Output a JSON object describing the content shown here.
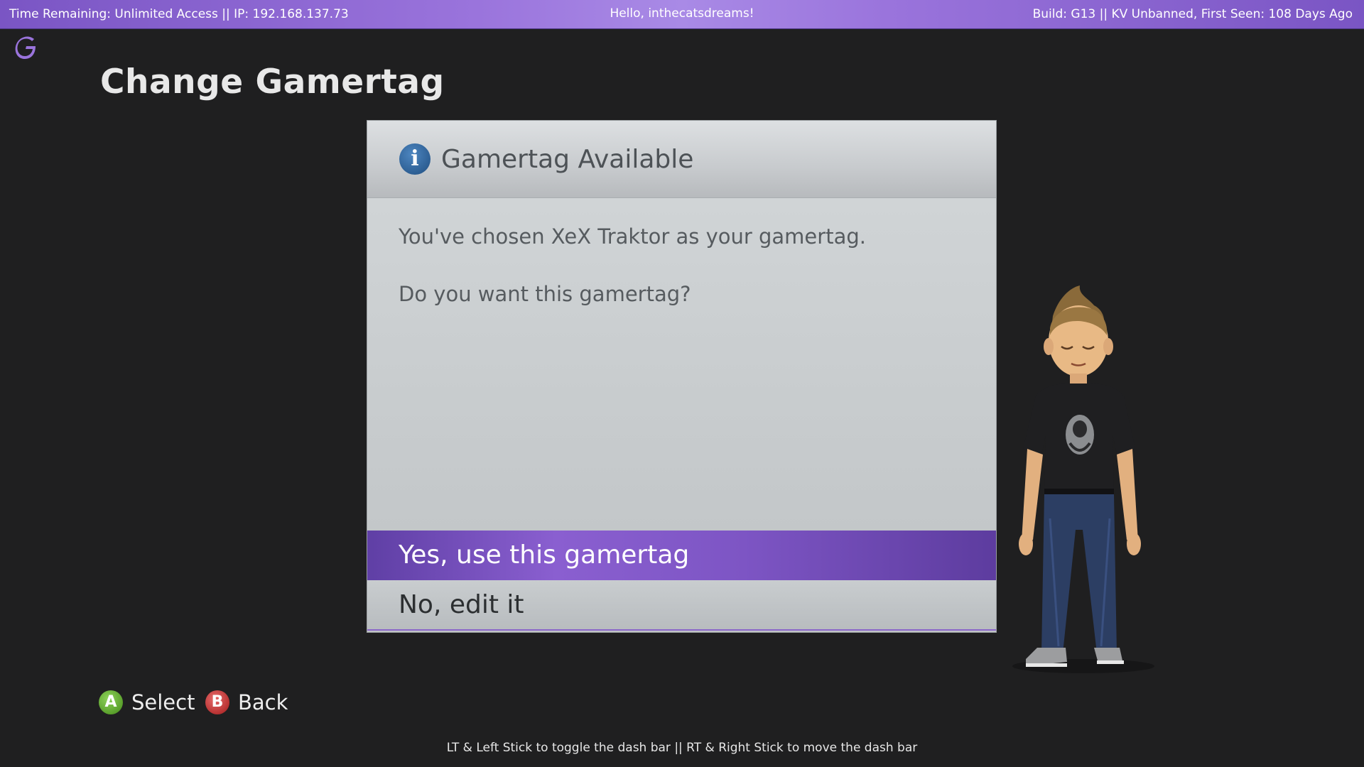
{
  "topbar": {
    "left_text": "Time Remaining: Unlimited Access || IP: 192.168.137.73",
    "center_text": "Hello, inthecatsdreams!",
    "right_text": "Build: G13 || KV Unbanned, First Seen: 108 Days Ago"
  },
  "logo": {
    "icon": "g-logo-icon",
    "letter": "G"
  },
  "page": {
    "title": "Change Gamertag"
  },
  "dialog": {
    "icon": "info-icon",
    "icon_glyph": "i",
    "title": "Gamertag Available",
    "message_line1": "You've chosen XeX Traktor as your gamertag.",
    "message_line2": "Do you want this gamertag?",
    "options": [
      {
        "label": "Yes, use this gamertag",
        "selected": true
      },
      {
        "label": "No, edit it",
        "selected": false
      }
    ]
  },
  "footer": {
    "a_button": {
      "glyph": "A",
      "label": "Select"
    },
    "b_button": {
      "glyph": "B",
      "label": "Back"
    },
    "hint": "LT & Left Stick to toggle the dash bar || RT & Right Stick to move the dash bar"
  },
  "colors": {
    "accent": "#8a5fd0",
    "topbar": "#9a74dc",
    "a_button": "#5aa02c",
    "b_button": "#b83232",
    "info_icon": "#2d5f94"
  }
}
